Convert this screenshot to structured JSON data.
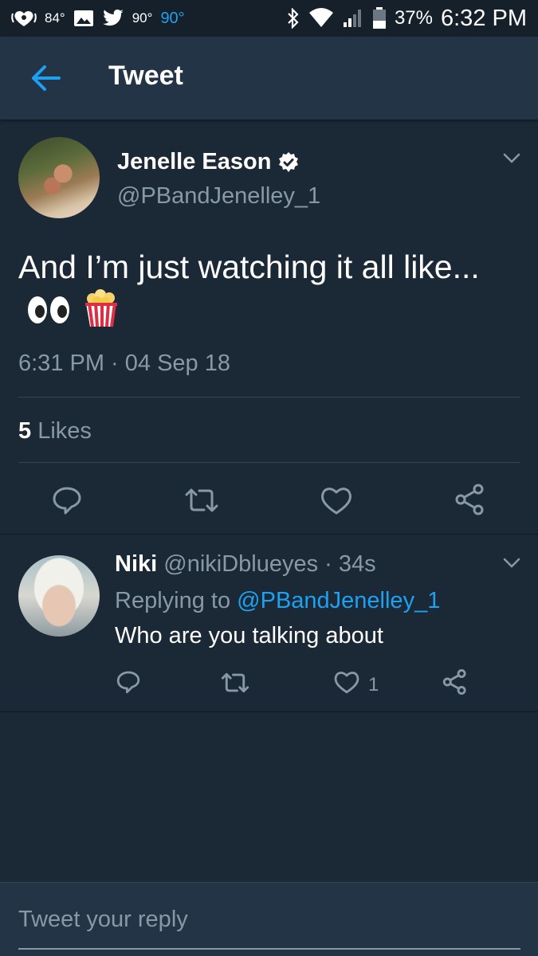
{
  "status_bar": {
    "temp1": "84°",
    "temp2": "90°",
    "temp3": "90°",
    "battery": "37%",
    "time": "6:32 PM"
  },
  "header": {
    "title": "Tweet"
  },
  "tweet": {
    "author_name": "Jenelle Eason",
    "handle": "@PBandJenelley_1",
    "text": "And I’m just watching it all like...",
    "emojis": [
      "eyes-emoji",
      "popcorn-emoji"
    ],
    "timestamp": "6:31 PM · 04 Sep 18",
    "likes_count": "5",
    "likes_label": "Likes"
  },
  "reply": {
    "name": "Niki",
    "handle": "@nikiDblueyes",
    "age": "· 34s",
    "replying_prefix": "Replying to",
    "replying_to": "@PBandJenelley_1",
    "text": "Who are you talking about",
    "like_count": "1"
  },
  "composer": {
    "placeholder": "Tweet your reply"
  },
  "colors": {
    "background": "#1b2836",
    "header": "#243447",
    "accent": "#1da1f2",
    "muted": "#8899a6"
  }
}
